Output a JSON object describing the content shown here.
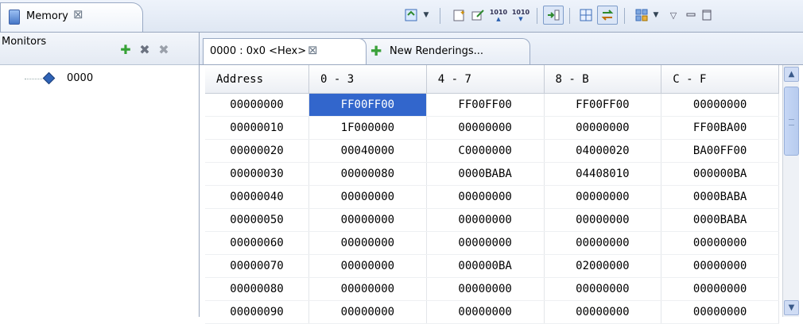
{
  "view_tab": {
    "title": "Memory",
    "close": "⊠"
  },
  "toolbar": {
    "tiny1": "1010",
    "tiny2": "1010"
  },
  "monitors": {
    "title": "Monitors",
    "items": [
      {
        "label": "0000"
      }
    ]
  },
  "renderings": {
    "tabs": [
      {
        "label": "0000 : 0x0 <Hex>",
        "close": "⊠"
      },
      {
        "label": "New Renderings..."
      }
    ]
  },
  "grid": {
    "headers": [
      "Address",
      "0 - 3",
      "4 - 7",
      "8 - B",
      "C - F"
    ],
    "rows": [
      [
        "00000000",
        "FF00FF00",
        "FF00FF00",
        "FF00FF00",
        "00000000"
      ],
      [
        "00000010",
        "1F000000",
        "00000000",
        "00000000",
        "FF00BA00"
      ],
      [
        "00000020",
        "00040000",
        "C0000000",
        "04000020",
        "BA00FF00"
      ],
      [
        "00000030",
        "00000080",
        "0000BABA",
        "04408010",
        "000000BA"
      ],
      [
        "00000040",
        "00000000",
        "00000000",
        "00000000",
        "0000BABA"
      ],
      [
        "00000050",
        "00000000",
        "00000000",
        "00000000",
        "0000BABA"
      ],
      [
        "00000060",
        "00000000",
        "00000000",
        "00000000",
        "00000000"
      ],
      [
        "00000070",
        "00000000",
        "000000BA",
        "02000000",
        "00000000"
      ],
      [
        "00000080",
        "00000000",
        "00000000",
        "00000000",
        "00000000"
      ],
      [
        "00000090",
        "00000000",
        "00000000",
        "00000000",
        "00000000"
      ]
    ],
    "selected": {
      "row": 0,
      "col": 1
    }
  }
}
